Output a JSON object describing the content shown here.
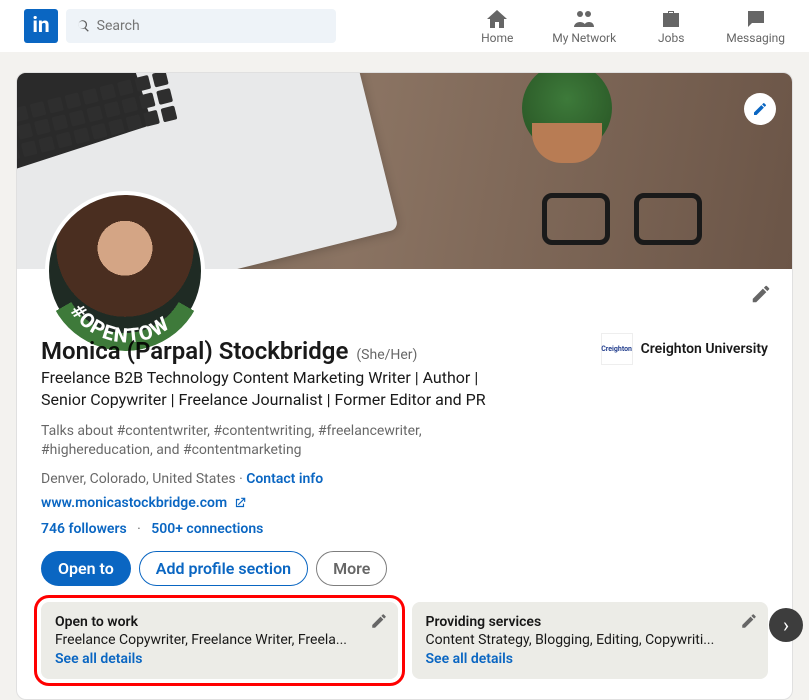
{
  "nav": {
    "search_placeholder": "Search",
    "items": [
      {
        "label": "Home"
      },
      {
        "label": "My Network"
      },
      {
        "label": "Jobs"
      },
      {
        "label": "Messaging"
      }
    ]
  },
  "profile": {
    "name": "Monica (Parpal) Stockbridge",
    "pronouns": "(She/Her)",
    "headline": "Freelance B2B Technology Content Marketing Writer | Author | Senior Copywriter | Freelance Journalist | Former Editor and PR",
    "talks": "Talks about #contentwriter, #contentwriting, #freelancewriter, #highereducation, and #contentmarketing",
    "location": "Denver, Colorado, United States",
    "contact_label": "Contact info",
    "website": "www.monicastockbridge.com",
    "followers": "746 followers",
    "connections": "500+ connections",
    "avatar_badge": "#OPENTOWORK",
    "education": {
      "name": "Creighton University",
      "logo_text": "Creighton"
    },
    "buttons": {
      "open_to": "Open to",
      "add_section": "Add profile section",
      "more": "More"
    },
    "cards": [
      {
        "title": "Open to work",
        "sub": "Freelance Copywriter, Freelance Writer, Freela...",
        "link": "See all details"
      },
      {
        "title": "Providing services",
        "sub": "Content Strategy, Blogging, Editing, Copywriti...",
        "link": "See all details"
      }
    ]
  }
}
